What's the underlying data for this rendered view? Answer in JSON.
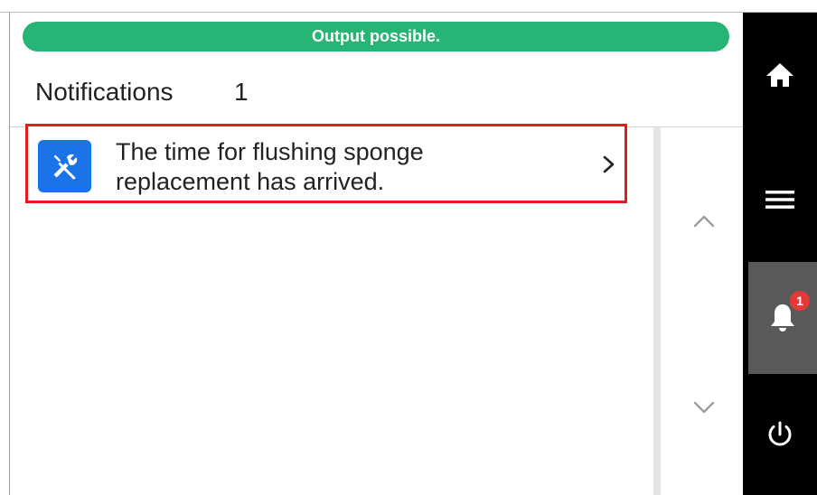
{
  "status": {
    "text": "Output possible.",
    "color": "#26b574"
  },
  "header": {
    "title": "Notifications",
    "count": "1"
  },
  "notifications": [
    {
      "icon": "maintenance-tools-icon",
      "text": "The time for flushing sponge replacement has arrived.",
      "highlight_color": "#e01e1e"
    }
  ],
  "sidebar": {
    "items": [
      {
        "name": "home",
        "icon": "home-icon"
      },
      {
        "name": "menu",
        "icon": "menu-icon"
      },
      {
        "name": "notifications",
        "icon": "bell-icon",
        "badge": "1",
        "active": true
      },
      {
        "name": "power",
        "icon": "power-icon"
      }
    ]
  },
  "scroll": {
    "up_icon": "chevron-up-icon",
    "down_icon": "chevron-down-icon"
  }
}
